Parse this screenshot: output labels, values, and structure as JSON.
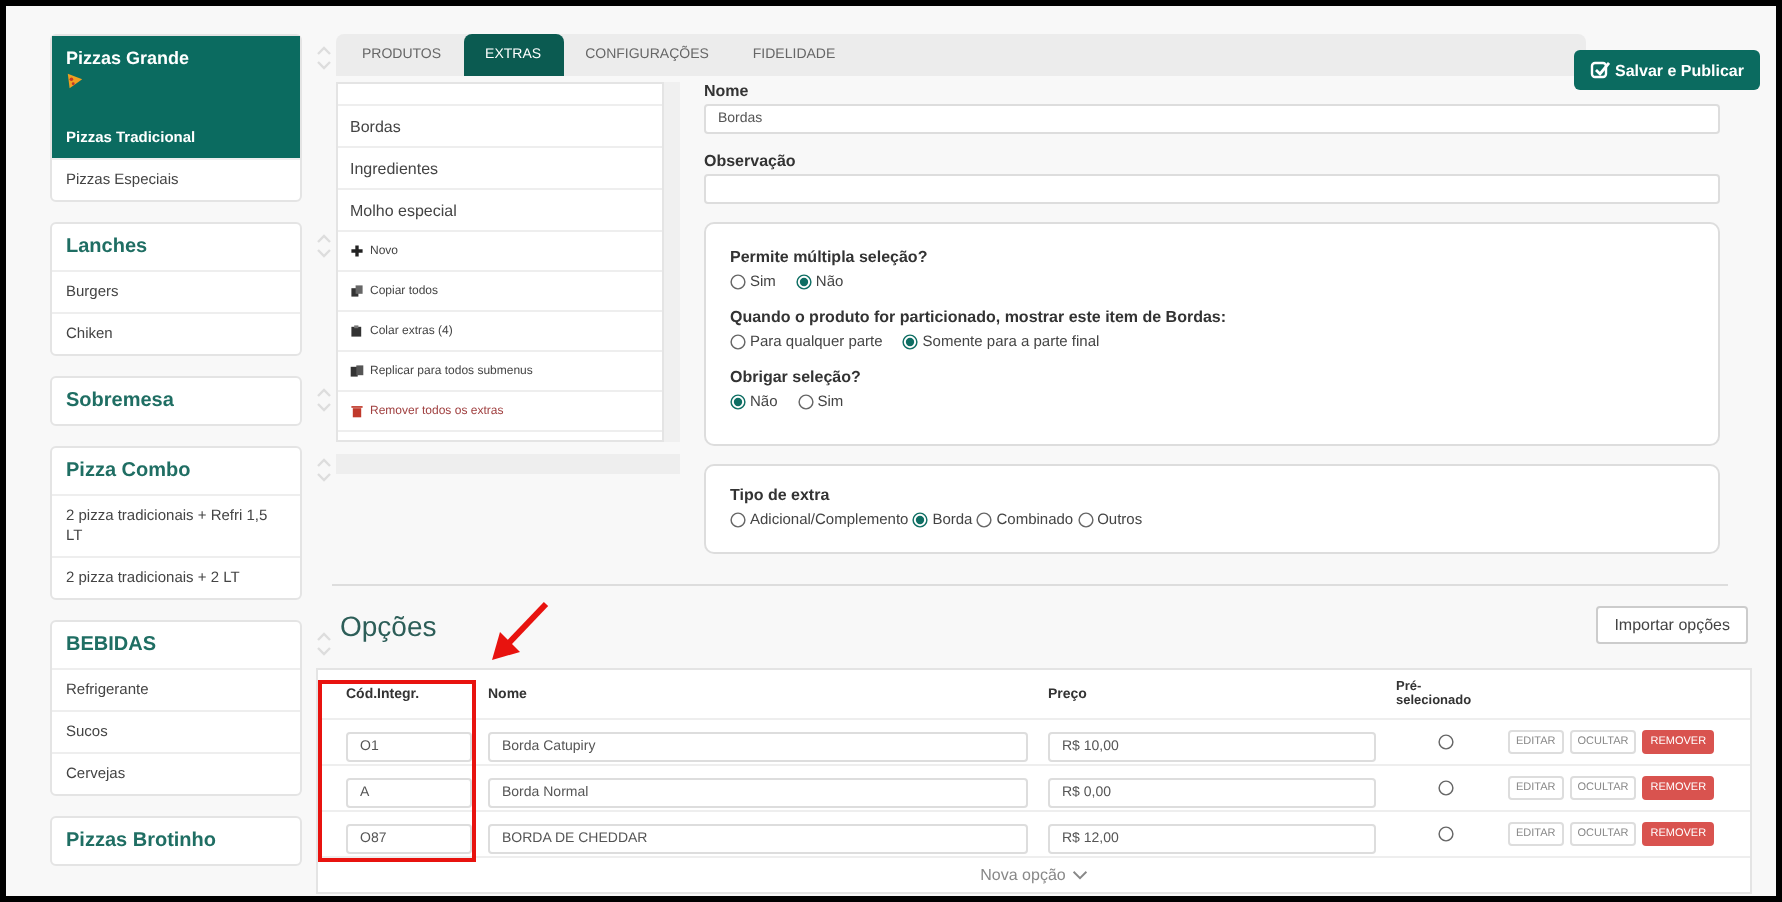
{
  "sidebar": {
    "groups": [
      {
        "title": "Pizzas Grande",
        "selected": true,
        "items": [
          {
            "label": "Pizzas Tradicional",
            "selected": true
          },
          {
            "label": "Pizzas Especiais",
            "selected": false
          }
        ]
      },
      {
        "title": "Lanches",
        "selected": false,
        "items": [
          {
            "label": "Burgers",
            "selected": false
          },
          {
            "label": "Chiken",
            "selected": false
          }
        ]
      },
      {
        "title": "Sobremesa",
        "selected": false
      },
      {
        "title": "Pizza Combo",
        "selected": false,
        "items": [
          {
            "label": "2 pizza tradicionais + Refri 1,5 LT",
            "selected": false
          },
          {
            "label": "2 pizza tradicionais + 2 LT",
            "selected": false
          }
        ]
      },
      {
        "title": "BEBIDAS",
        "selected": false,
        "items": [
          {
            "label": "Refrigerante",
            "selected": false
          },
          {
            "label": "Sucos",
            "selected": false
          },
          {
            "label": "Cervejas",
            "selected": false
          }
        ]
      },
      {
        "title": "Pizzas Brotinho",
        "selected": false
      }
    ]
  },
  "tabs": [
    {
      "label": "PRODUTOS",
      "selected": false
    },
    {
      "label": "EXTRAS",
      "selected": true
    },
    {
      "label": "CONFIGURAÇÕES",
      "selected": false
    },
    {
      "label": "FIDELIDADE",
      "selected": false
    }
  ],
  "save_button": "Salvar e Publicar",
  "extras_list": [
    {
      "kind": "extra",
      "label": "Bordas"
    },
    {
      "kind": "extra",
      "label": "Ingredientes"
    },
    {
      "kind": "extra",
      "label": "Molho especial"
    },
    {
      "kind": "new",
      "label": "Novo"
    },
    {
      "kind": "copy",
      "label": "Copiar todos"
    },
    {
      "kind": "paste",
      "label": "Colar extras (4)"
    },
    {
      "kind": "replicate",
      "label": "Replicar para todos submenus"
    },
    {
      "kind": "remove",
      "label": "Remover todos os extras"
    }
  ],
  "form": {
    "name_label": "Nome",
    "name_value": "Bordas",
    "note_label": "Observação",
    "questions": [
      {
        "label": "Permite múltipla seleção?",
        "options": [
          {
            "label": "Sim",
            "selected": false
          },
          {
            "label": "Não",
            "selected": true
          }
        ]
      },
      {
        "label": "Quando o produto for particionado, mostrar este item de Bordas:",
        "options": [
          {
            "label": "Para qualquer parte",
            "selected": false
          },
          {
            "label": "Somente para a parte final",
            "selected": true
          }
        ]
      },
      {
        "label": "Obrigar seleção?",
        "options": [
          {
            "label": "Não",
            "selected": true
          },
          {
            "label": "Sim",
            "selected": false
          }
        ]
      }
    ],
    "extra_type": {
      "label": "Tipo de extra",
      "options": [
        {
          "label": "Adicional/Complemento",
          "selected": false
        },
        {
          "label": "Borda",
          "selected": true
        },
        {
          "label": "Combinado",
          "selected": false
        },
        {
          "label": "Outros",
          "selected": false
        }
      ]
    }
  },
  "options": {
    "title": "Opções",
    "import_button": "Importar opções",
    "columns": [
      "Cód.Integr.",
      "Nome",
      "Preço",
      "Pré-selecionado"
    ],
    "rows": [
      {
        "code": "O1",
        "name": "Borda Catupiry",
        "price": "R$ 10,00",
        "preselected": false,
        "actions": [
          "EDITAR",
          "OCULTAR",
          "REMOVER"
        ]
      },
      {
        "code": "A",
        "name": "Borda Normal",
        "price": "R$ 0,00",
        "preselected": false,
        "actions": [
          "EDITAR",
          "OCULTAR",
          "REMOVER"
        ]
      },
      {
        "code": "O87",
        "name": "BORDA DE CHEDDAR",
        "price": "R$ 12,00",
        "preselected": false,
        "actions": [
          "EDITAR",
          "OCULTAR",
          "REMOVER"
        ]
      }
    ],
    "new_option": "Nova opção"
  }
}
